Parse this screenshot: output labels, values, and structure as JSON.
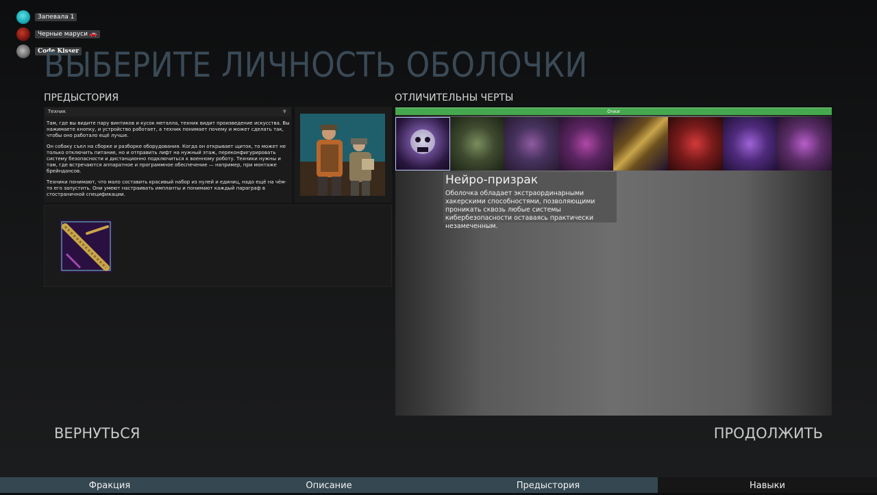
{
  "players": [
    {
      "name": "Запевала 1"
    },
    {
      "name": "Черные маруси 🚗"
    },
    {
      "name": "Code Kisser"
    }
  ],
  "page_title": "ВЫБЕРИТЕ ЛИЧНОСТЬ ОБОЛОЧКИ",
  "backstory": {
    "label": "ПРЕДЫСТОРИЯ",
    "selected": "Техник",
    "paragraphs": [
      "Там, где вы видите пару винтиков и кусок металла, техник видит произведение искусства. Вы нажимаете кнопку, и устройство работает, а техник понимает почему и может сделать так, чтобы оно работало ещё лучше.",
      "Он собаку съел на сборке и разборке оборудования. Когда он открывает щиток, то может не только отключить питание, но и отправить лифт на нужный этаж, переконфигурировать систему безопасности и дистанционно подключиться к военному роботу. Техники нужны и там, где встречаются аппаратное и программное обеспечение — например, при монтаже брейндансов.",
      "Техники понимают, что мало составить красивый набор из нулей и единиц, надо ещё на чём-то его запустить. Они умеют настраивать импланты и понимают каждый параграф в стостраничной спецификации."
    ]
  },
  "traits": {
    "label": "ОТЛИЧИТЕЛЬНЫ ЧЕРТЫ",
    "points_label": "Очки",
    "tiles": [
      "neuro-ghost",
      "tentacle-hacker",
      "circuit-mask",
      "pink-cyborg",
      "golden-tentacle",
      "red-demon",
      "purple-rogue",
      "violet-brawler"
    ],
    "tooltip": {
      "title": "Нейро-призрак",
      "text": "Оболочка обладает экстраординарными хакерскими способностями, позволяющими проникать сквозь любые системы кибербезопасности оставаясь практически незамеченным."
    }
  },
  "nav": {
    "back": "ВЕРНУТЬСЯ",
    "next": "ПРОДОЛЖИТЬ"
  },
  "tabs": [
    {
      "label": "Фракция",
      "active": false
    },
    {
      "label": "Описание",
      "active": false
    },
    {
      "label": "Предыстория",
      "active": false
    },
    {
      "label": "Навыки",
      "active": true
    }
  ]
}
